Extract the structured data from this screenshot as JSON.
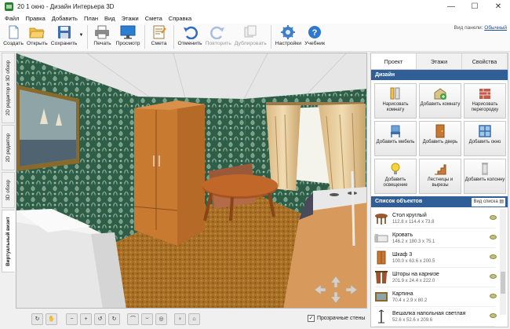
{
  "window": {
    "title": "20 1 окно - Дизайн Интерьера 3D",
    "controls": [
      "—",
      "☐",
      "✕"
    ]
  },
  "menu": [
    "Файл",
    "Правка",
    "Добавить",
    "План",
    "Вид",
    "Этажи",
    "Смета",
    "Справка"
  ],
  "toolbar": {
    "create": "Создать",
    "open": "Открыть",
    "save": "Сохранить",
    "print": "Печать",
    "preview": "Просмотр",
    "estimate": "Смета",
    "undo": "Отменить",
    "redo": "Повторить",
    "duplicate": "Дублировать",
    "settings": "Настройки",
    "tutorial": "Учебник",
    "panel_view_label": "Вид панели:",
    "panel_view_value": "Обычный"
  },
  "view_tabs": [
    "2D редактор и 3D обзор",
    "2D редактор",
    "3D обзор",
    "Виртуальный визит"
  ],
  "active_view_tab": "Виртуальный визит",
  "viewport": {
    "transparent_walls_label": "Прозрачные стены",
    "transparent_walls_checked": true
  },
  "right_panel": {
    "tabs": [
      "Проект",
      "Этажи",
      "Свойства"
    ],
    "active_tab": "Проект",
    "section_title": "Дизайн",
    "design_buttons": [
      {
        "label": "Нарисовать комнату",
        "icon": "pencil-ruler-icon"
      },
      {
        "label": "Добавить комнату",
        "icon": "add-room-icon"
      },
      {
        "label": "Нарисовать перегородку",
        "icon": "brick-wall-icon"
      },
      {
        "label": "Добавить мебель",
        "icon": "chair-icon"
      },
      {
        "label": "Добавить дверь",
        "icon": "door-icon"
      },
      {
        "label": "Добавить окно",
        "icon": "window-icon"
      },
      {
        "label": "Добавить освещение",
        "icon": "lightbulb-icon"
      },
      {
        "label": "Лестницы и вырезы",
        "icon": "stairs-icon"
      },
      {
        "label": "Добавить колонну",
        "icon": "column-icon"
      }
    ],
    "list_title": "Список объектов",
    "list_view_label": "Вид списка",
    "objects": [
      {
        "name": "Стол круглый",
        "dims": "112.8 x 114.4 x 73.8",
        "icon": "round-table-icon"
      },
      {
        "name": "Кровать",
        "dims": "146.2 x 180.3 x 75.1",
        "icon": "bed-icon"
      },
      {
        "name": "Шкаф 3",
        "dims": "100.0 x 63.6 x 200.5",
        "icon": "wardrobe-icon"
      },
      {
        "name": "Шторы на карнизе",
        "dims": "201.9 x 24.4 x 222.0",
        "icon": "curtains-icon"
      },
      {
        "name": "Картина",
        "dims": "70.4 x 2.9 x 80.2",
        "icon": "picture-icon"
      },
      {
        "name": "Вешалка напольная светлая",
        "dims": "52.6 x 52.6 x 209.6",
        "icon": "floor-hanger-icon"
      }
    ]
  },
  "colors": {
    "accent": "#2f5f96",
    "wall": "#3a6a4e",
    "floor": "#b37b2c",
    "wood": "#c9782f"
  }
}
